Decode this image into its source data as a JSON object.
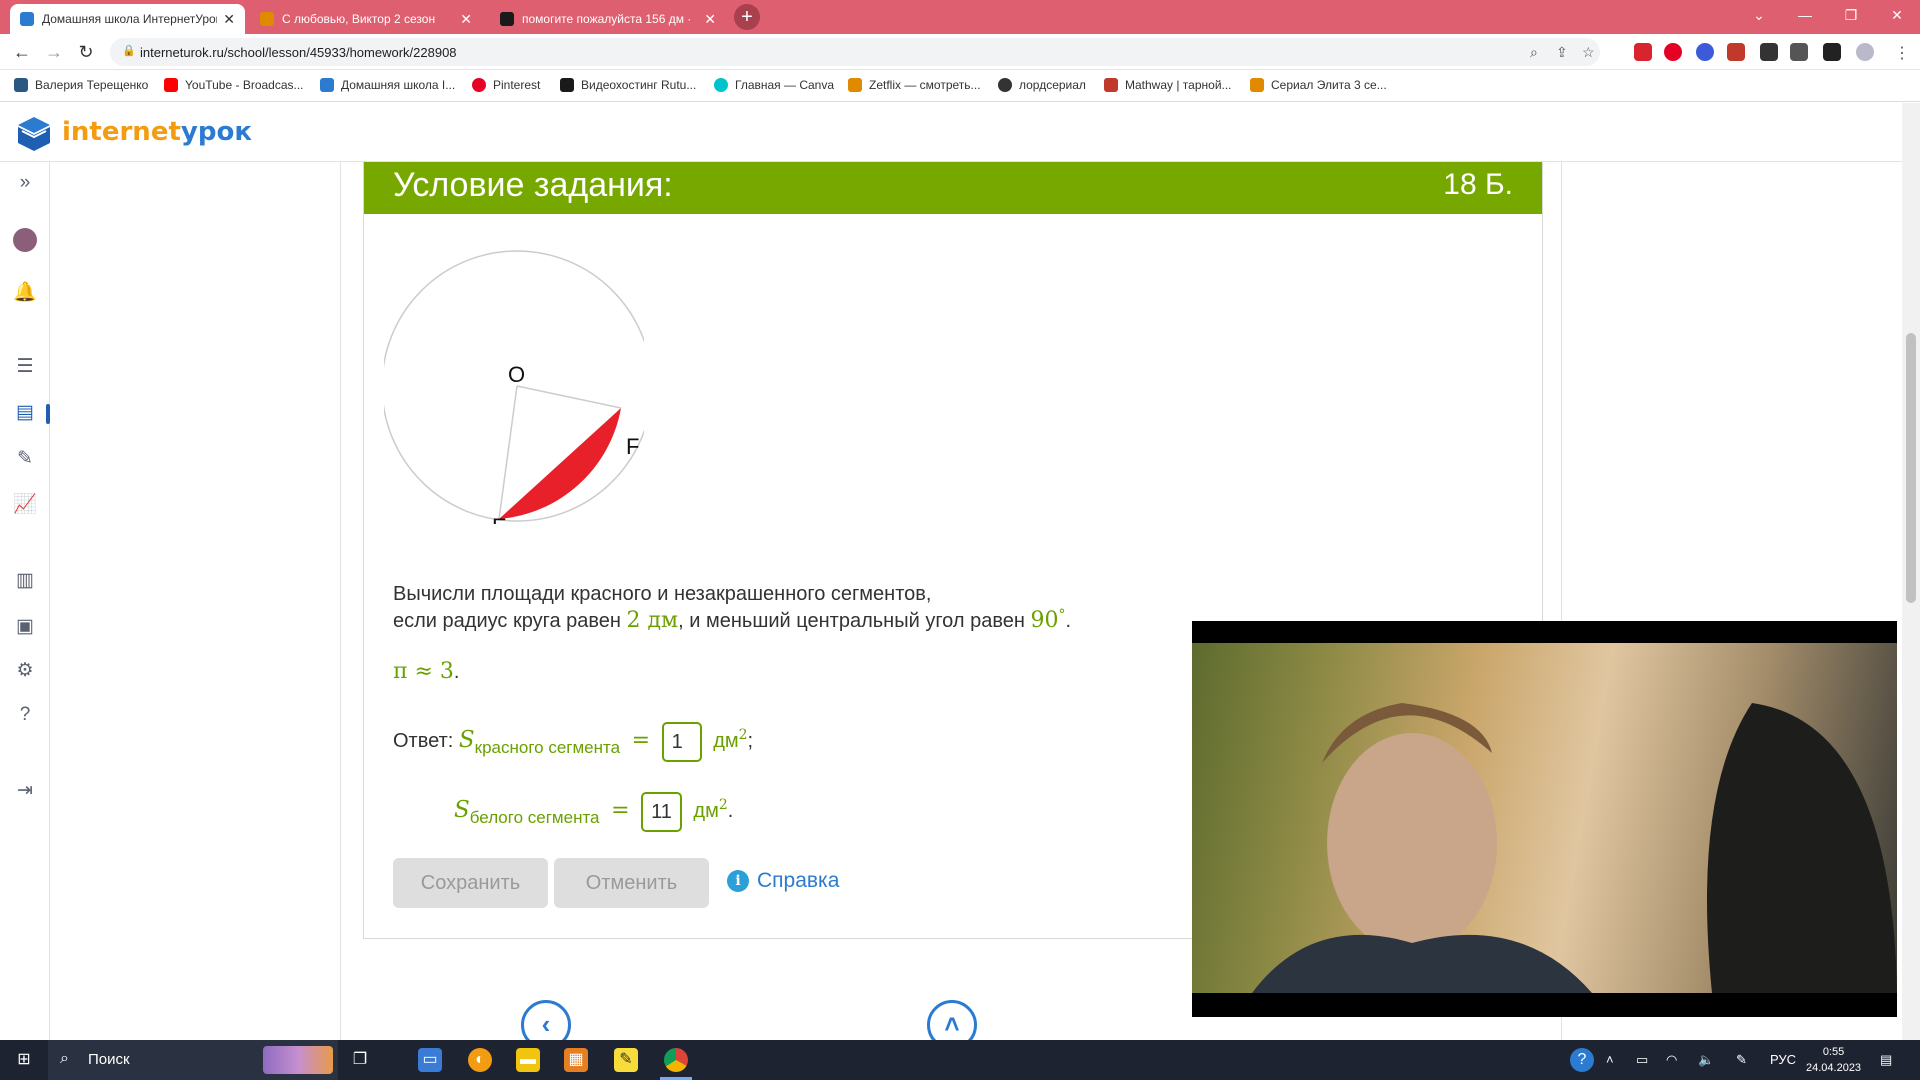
{
  "browser": {
    "tabs": [
      {
        "title": "Домашняя школа ИнтернетУрок",
        "active": true
      },
      {
        "title": "С любовью, Виктор 2 сезон",
        "active": false
      },
      {
        "title": "помогите пожалуйста 156 дм ·",
        "active": false
      }
    ],
    "url": "interneturok.ru/school/lesson/45933/homework/228908",
    "bookmarks": [
      {
        "label": "Валерия Терещенко",
        "color": "#2a5885"
      },
      {
        "label": "YouTube - Broadcas...",
        "color": "#ff0000"
      },
      {
        "label": "Домашняя школа I...",
        "color": "#2b7bd1"
      },
      {
        "label": "Pinterest",
        "color": "#e60023"
      },
      {
        "label": "Видеохостинг Rutu...",
        "color": "#1a1a1a"
      },
      {
        "label": "Главная — Canva",
        "color": "#00c4cc"
      },
      {
        "label": "Zetflix — смотреть...",
        "color": "#e08a00"
      },
      {
        "label": "лордсериал",
        "color": "#333333"
      },
      {
        "label": "Mathway | тарной...",
        "color": "#c0392b"
      },
      {
        "label": "Сериал Элита 3 се...",
        "color": "#e08a00"
      }
    ]
  },
  "site": {
    "logo_part1": "internet",
    "logo_part2": "урок"
  },
  "task": {
    "header_title": "Условие задания:",
    "score": "18 Б.",
    "diagram_labels": {
      "center": "O",
      "point_f": "F",
      "point_e": "E"
    },
    "line1": "Вычисли площади красного и незакрашенного сегментов,",
    "line2_a": "если радиус круга равен ",
    "radius": "2 дм",
    "line2_b": ", и меньший центральный угол равен ",
    "angle": "90",
    "degree": "°",
    "line2_end": ".",
    "pi_text": "π ≈ 3",
    "pi_end": ".",
    "answer_label": "Ответ:",
    "s_letter": "S",
    "red_sub": "красного сегмента",
    "white_sub": "белого сегмента",
    "equals": "=",
    "red_value": "1",
    "white_value": "11",
    "unit": "дм",
    "unit_power": "2",
    "red_end": ";",
    "white_end": ".",
    "save_label": "Сохранить",
    "cancel_label": "Отменить",
    "help_label": "Справка",
    "help_icon_glyph": "i"
  },
  "taskbar": {
    "search_label": "Поиск",
    "lang": "РУС",
    "time": "0:55",
    "date": "24.04.2023"
  },
  "colors": {
    "green": "#76a800",
    "tab_bar": "#de5f6f",
    "segment_red": "#e8202a",
    "link_blue": "#2b7bd1"
  }
}
